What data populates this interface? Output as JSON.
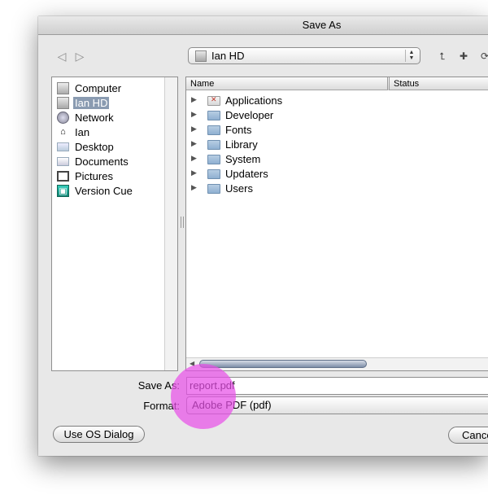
{
  "window": {
    "title": "Save As"
  },
  "toolbar": {
    "back_icon": "back-arrow-icon",
    "forward_icon": "forward-arrow-icon",
    "location": "Ian HD",
    "icons": [
      "up-folder-icon",
      "new-folder-icon",
      "refresh-icon"
    ]
  },
  "sidebar": {
    "items": [
      {
        "label": "Computer",
        "icon": "computer-icon"
      },
      {
        "label": "Ian HD",
        "icon": "hard-disk-icon",
        "selected": true
      },
      {
        "label": "Network",
        "icon": "network-icon"
      },
      {
        "label": "Ian",
        "icon": "home-icon"
      },
      {
        "label": "Desktop",
        "icon": "desktop-icon"
      },
      {
        "label": "Documents",
        "icon": "documents-icon"
      },
      {
        "label": "Pictures",
        "icon": "pictures-icon"
      },
      {
        "label": "Version Cue",
        "icon": "version-cue-icon"
      }
    ]
  },
  "browser": {
    "columns": [
      "Name",
      "Status"
    ],
    "rows": [
      {
        "name": "Applications",
        "icon": "applications-folder-icon"
      },
      {
        "name": "Developer",
        "icon": "developer-folder-icon"
      },
      {
        "name": "Fonts",
        "icon": "folder-icon"
      },
      {
        "name": "Library",
        "icon": "library-folder-icon"
      },
      {
        "name": "System",
        "icon": "system-folder-icon"
      },
      {
        "name": "Updaters",
        "icon": "folder-icon"
      },
      {
        "name": "Users",
        "icon": "users-folder-icon"
      }
    ]
  },
  "form": {
    "save_as_label": "Save As:",
    "save_as_value": "report.pdf",
    "format_label": "Format:",
    "format_value": "Adobe PDF (pdf)"
  },
  "buttons": {
    "use_os_dialog": "Use OS Dialog",
    "cancel": "Cance"
  },
  "colors": {
    "selection": "#8a9bb1",
    "click_marker": "#e850e8"
  }
}
